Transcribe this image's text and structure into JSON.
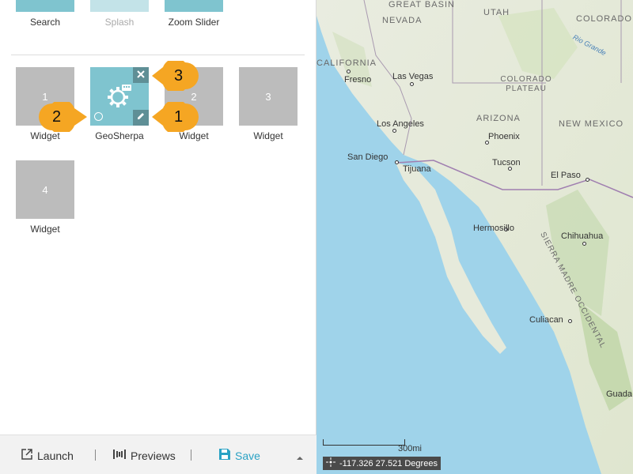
{
  "top_widgets": [
    {
      "label": "Search",
      "state": "enabled"
    },
    {
      "label": "Splash",
      "state": "disabled"
    },
    {
      "label": "Zoom Slider",
      "state": "enabled"
    }
  ],
  "widget_slots": [
    {
      "number": "1",
      "label": "Widget"
    },
    {
      "number": "",
      "label": "GeoSherpa"
    },
    {
      "number": "2",
      "label": "Widget"
    },
    {
      "number": "3",
      "label": "Widget"
    },
    {
      "number": "4",
      "label": "Widget"
    }
  ],
  "callouts": [
    "1",
    "2",
    "3"
  ],
  "footer": {
    "launch_label": "Launch",
    "previews_label": "Previews",
    "save_label": "Save"
  },
  "map": {
    "states": [
      "NEVADA",
      "UTAH",
      "COLORADO",
      "CALIFORNIA",
      "ARIZONA",
      "NEW MEXICO",
      "COLORADO PLATEAU",
      "GREAT BASIN",
      "SIERRA MADRE OCCIDENTAL"
    ],
    "cities": [
      "Fresno",
      "Las Vegas",
      "Los Angeles",
      "Phoenix",
      "San Diego",
      "Tijuana",
      "Tucson",
      "El Paso",
      "Hermosillo",
      "Chihuahua",
      "Culiacan",
      "Guada"
    ],
    "rivers": [
      "Rio Grande"
    ],
    "scale_label": "300mi",
    "coordinates": "-117.326 27.521 Degrees"
  },
  "colors": {
    "tile_active": "#7fc4cf",
    "tile_gray": "#bcbcbc",
    "callout": "#f5a623",
    "save_accent": "#2aa2c4"
  }
}
